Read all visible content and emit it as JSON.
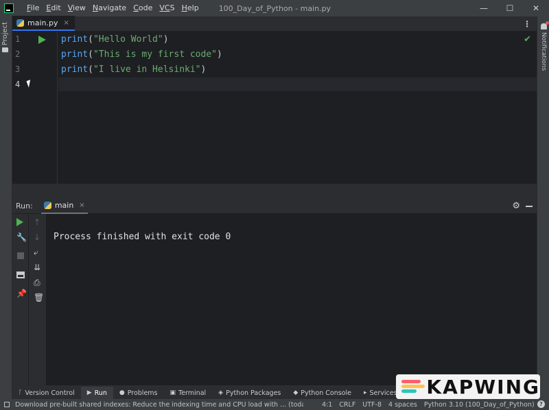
{
  "titlebar": {
    "menu": [
      {
        "u": "F",
        "rest": "ile"
      },
      {
        "u": "E",
        "rest": "dit"
      },
      {
        "u": "V",
        "rest": "iew"
      },
      {
        "u": "N",
        "rest": "avigate"
      },
      {
        "u": "C",
        "rest": "ode"
      },
      {
        "u": "VC",
        "rest": "S"
      },
      {
        "u": "H",
        "rest": "elp"
      }
    ],
    "window_title": "100_Day_of_Python - main.py",
    "minimize_glyph": "—",
    "maximize_glyph": "☐",
    "close_glyph": "✕"
  },
  "left_strip": {
    "project_label": "Project"
  },
  "right_strip": {
    "notifications_label": "Notifications"
  },
  "editor": {
    "tab_label": "main.py",
    "tab_close": "×",
    "more_glyph": "⋮",
    "line_numbers": [
      "1",
      "2",
      "3",
      "4"
    ],
    "lines": [
      {
        "fn": "print",
        "open": "(",
        "str": "\"Hello World\"",
        "close": ")"
      },
      {
        "fn": "print",
        "open": "(",
        "str": "\"This is my first code\"",
        "close": ")"
      },
      {
        "fn": "print",
        "open": "(",
        "str": "\"I live in Helsinki\"",
        "close": ")"
      }
    ],
    "check_glyph": "✔"
  },
  "run": {
    "label": "Run:",
    "tab_label": "main",
    "tab_close": "×",
    "gear_glyph": "⚙",
    "console_output": "Process finished with exit code 0",
    "toolbar_icons": [
      "rerun-icon",
      "wrench-icon",
      "stop-icon",
      "layout-icon",
      "pin-icon"
    ],
    "toolbar2_icons": [
      "up-icon",
      "down-icon",
      "soft-wrap-icon",
      "scroll-end-icon",
      "print-icon",
      "trash-icon"
    ]
  },
  "bottom_tabs": [
    {
      "label": "Version Control",
      "icon": "ᚴ"
    },
    {
      "label": "Run",
      "icon": "▶"
    },
    {
      "label": "Problems",
      "icon": "●"
    },
    {
      "label": "Terminal",
      "icon": "▣"
    },
    {
      "label": "Python Packages",
      "icon": "◈"
    },
    {
      "label": "Python Console",
      "icon": "◆"
    },
    {
      "label": "Services",
      "icon": "▸"
    }
  ],
  "statusbar": {
    "message": "Download pre-built shared indexes: Reduce the indexing time and CPU load with ... (today 21:1",
    "position": "4:1",
    "line_sep": "CRLF",
    "encoding": "UTF-8",
    "indent": "4 spaces",
    "interpreter": "Python 3.10 (100_Day_of_Python)"
  },
  "watermark": {
    "text": "KAPWING"
  },
  "colors": {
    "accent": "#3574f0",
    "run_green": "#4eb34e",
    "string": "#6aab73",
    "function": "#56a8f5"
  }
}
